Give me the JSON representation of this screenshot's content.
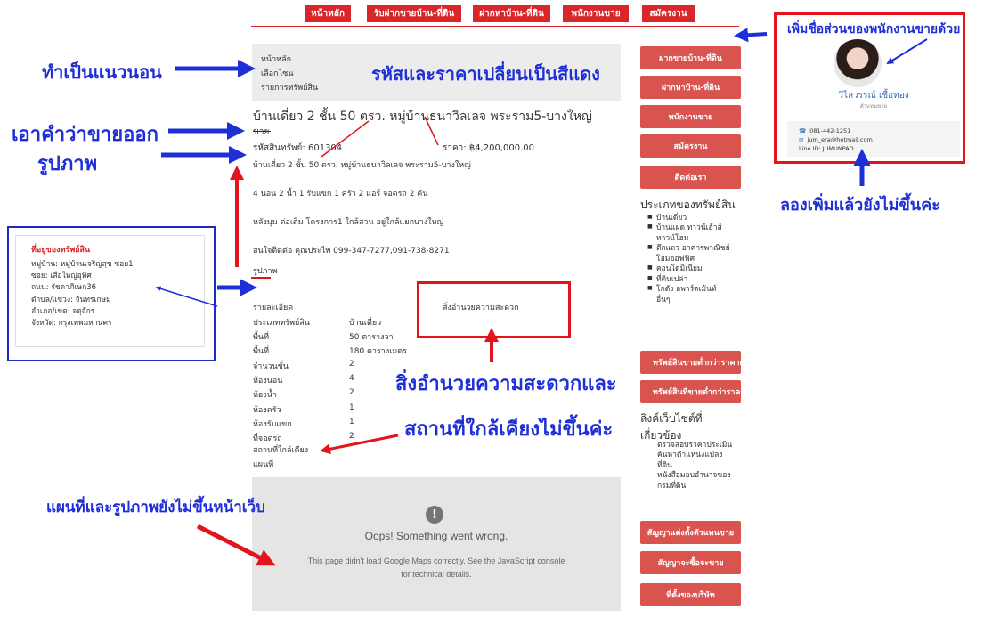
{
  "nav": [
    "หน้าหลัก",
    "รับฝากขายบ้าน-ที่ดิน",
    "ฝากหาบ้าน-ที่ดิน",
    "พนักงานขาย",
    "สมัครงาน"
  ],
  "breadcrumb": [
    "หน้าหลัก",
    "เลือกโซน",
    "รายการทรัพย์สิน"
  ],
  "listing": {
    "title": "บ้านเดี่ยว 2 ชั้น 50 ตรว. หมู่บ้านธนาวิลเลจ พระราม5-บางใหญ่",
    "status": "ขาย",
    "code_label": "รหัสสินทรัพย์:",
    "code": "601304",
    "price_label": "ราคา:",
    "price": "฿4,200,000.00",
    "desc": [
      "บ้านเดี่ยว 2 ชั้น 50 ตรว. หมู่บ้านธนาวิลเลจ พระราม5-บางใหญ่",
      "4 นอน 2 น้ำ 1 รับแขก 1 ครัว 2 แอร์ จอดรถ 2 คัน",
      "หลังมุม ต่อเติม โครงการ1 ใกล้สวน อยู่ใกล้แยกบางใหญ่",
      "สนใจติดต่อ คุณประไพ 099-347-7277,091-738-8271"
    ],
    "images_label": "รูปภาพ",
    "details_label": "รายละเอียด",
    "facilities_label": "สิ่งอำนวยความสะดวก",
    "details": [
      [
        "ประเภททรัพย์สิน",
        "บ้านเดี่ยว"
      ],
      [
        "พื้นที่",
        "50 ตารางวา"
      ],
      [
        "พื้นที่",
        "180 ตารางเมตร"
      ],
      [
        "จำนวนชั้น",
        "2"
      ],
      [
        "ห้องนอน",
        "4"
      ],
      [
        "ห้องน้ำ",
        "2"
      ],
      [
        "ห้องครัว",
        "1"
      ],
      [
        "ห้องรับแขก",
        "1"
      ],
      [
        "ที่จอดรถ",
        "2"
      ]
    ],
    "nearby_label": "สถานที่ใกล้เคียง",
    "map_label": "แผนที่"
  },
  "map_error": {
    "icon": "!",
    "title": "Oops! Something went wrong.",
    "line1": "This page didn't load Google Maps correctly. See the JavaScript console",
    "line2": "for technical details."
  },
  "sidebar": {
    "buttons_top": [
      "ฝากขายบ้าน-ที่ดิน",
      "ฝากหาบ้าน-ที่ดิน",
      "พนักงานขาย",
      "สมัครงาน",
      "ติดต่อเรา"
    ],
    "types_heading": "ประเภทของทรัพย์สิน",
    "types": [
      "บ้านเดี่ยว",
      "บ้านแฝด ทาวน์เฮ้าส์",
      "ทาวน์โฮม",
      "ตึกแถว อาคารพาณิชย์",
      "โฮมออฟฟิศ",
      "คอนโดมิเนียม",
      "ที่ดินเปล่า",
      "โกดัง อพาร์ตเม้นท์",
      "อื่นๆ"
    ],
    "buttons_mid": [
      "ทรัพย์สินขายต่ำกว่าราคาตลาด",
      "ทรัพย์สินที่ขายต่ำกว่าราคาประเมิน"
    ],
    "links_heading1": "ลิงค์เว็บไซต์ที่",
    "links_heading2": "เกี่ยวข้อง",
    "links": [
      "ตรวจสอบราคาประเมิน",
      "ค้นหาตำแหน่งแปลง",
      "ที่ดิน",
      "หนังสือมอบอำนาจของ",
      "กรมที่ดิน"
    ],
    "buttons_bottom": [
      "สัญญาแต่งตั้งตัวแทนขาย",
      "สัญญาจะซื้อจะขาย",
      "ที่ตั้งของบริษัท"
    ]
  },
  "address": {
    "heading": "ที่อยู่ของทรัพย์สิน",
    "lines": [
      "หมู่บ้าน: หมู่บ้านเจริญสุข ซอย1",
      "ซอย: เสือใหญ่อุทิศ",
      "ถนน: รัชดาภิเษก36",
      "ตำบล/แขวง: จันทรเกษม",
      "อำเภอ/เขต: จตุจักร",
      "จังหวัด: กรุงเทพมหานคร"
    ]
  },
  "agent": {
    "name": "วิไลวรรณ์ เชื้อทอง",
    "role": "ตัวแทนขาย",
    "phone": "081-442-1251",
    "email": "jum_era@hotmail.com",
    "line": "Line ID: JUMUNPAO",
    "icons": [
      "phone-icon",
      "email-icon"
    ]
  },
  "annotations": {
    "horizontal": "ทำเป็นแนวนอน",
    "red_code_price": "รหัสและราคาเปลี่ยนเป็นสีแดง",
    "remove_sale": "เอาคำว่าขายออก",
    "images": "รูปภาพ",
    "add_agent": "เพิ่มชื่อส่วนของพนักงานขายด้วย",
    "tried_add": "ลองเพิ่มแล้วยังไม่ขึ้นค่ะ",
    "facilities_1": "สิ่งอำนวยความสะดวกและ",
    "facilities_2": "สถานที่ใกล้เคียงไม่ขึ้นค่ะ",
    "map_images": "แผนที่และรูปภาพยังไม่ขึ้นหน้าเว็บ"
  },
  "colors": {
    "red": "#d9262a",
    "button": "#d9534f",
    "annotation_blue": "#1f2fd8",
    "annotation_red": "#e3141b"
  }
}
